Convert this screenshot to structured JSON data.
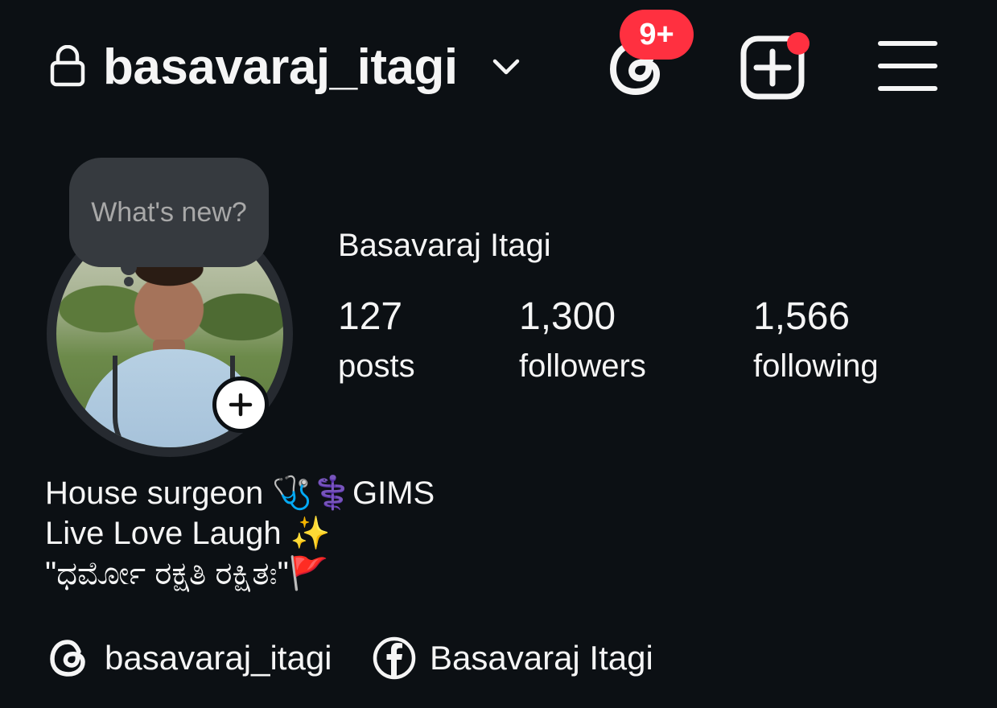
{
  "header": {
    "username": "basavaraj_itagi",
    "threads_badge": "9+"
  },
  "note": {
    "placeholder": "What's new?"
  },
  "profile": {
    "display_name": "Basavaraj Itagi",
    "stats": [
      {
        "value": "127",
        "label": "posts"
      },
      {
        "value": "1,300",
        "label": "followers"
      },
      {
        "value": "1,566",
        "label": "following"
      }
    ]
  },
  "bio": {
    "lines": [
      "House surgeon 🩺⚕️GIMS",
      "Live Love Laugh ✨",
      "\"ಧರ್ಮೋ ರಕ್ಷತಿ ರಕ್ಷಿತಃ\"🚩"
    ]
  },
  "links": {
    "threads": "basavaraj_itagi",
    "facebook": "Basavaraj Itagi"
  },
  "colors": {
    "background": "#0c1014",
    "text": "#f5f5f5",
    "badge": "#ff3040",
    "note_bubble": "#363a3f"
  },
  "icons": [
    "lock-icon",
    "chevron-down-icon",
    "threads-icon",
    "create-post-icon",
    "hamburger-menu-icon",
    "plus-icon",
    "facebook-icon"
  ]
}
